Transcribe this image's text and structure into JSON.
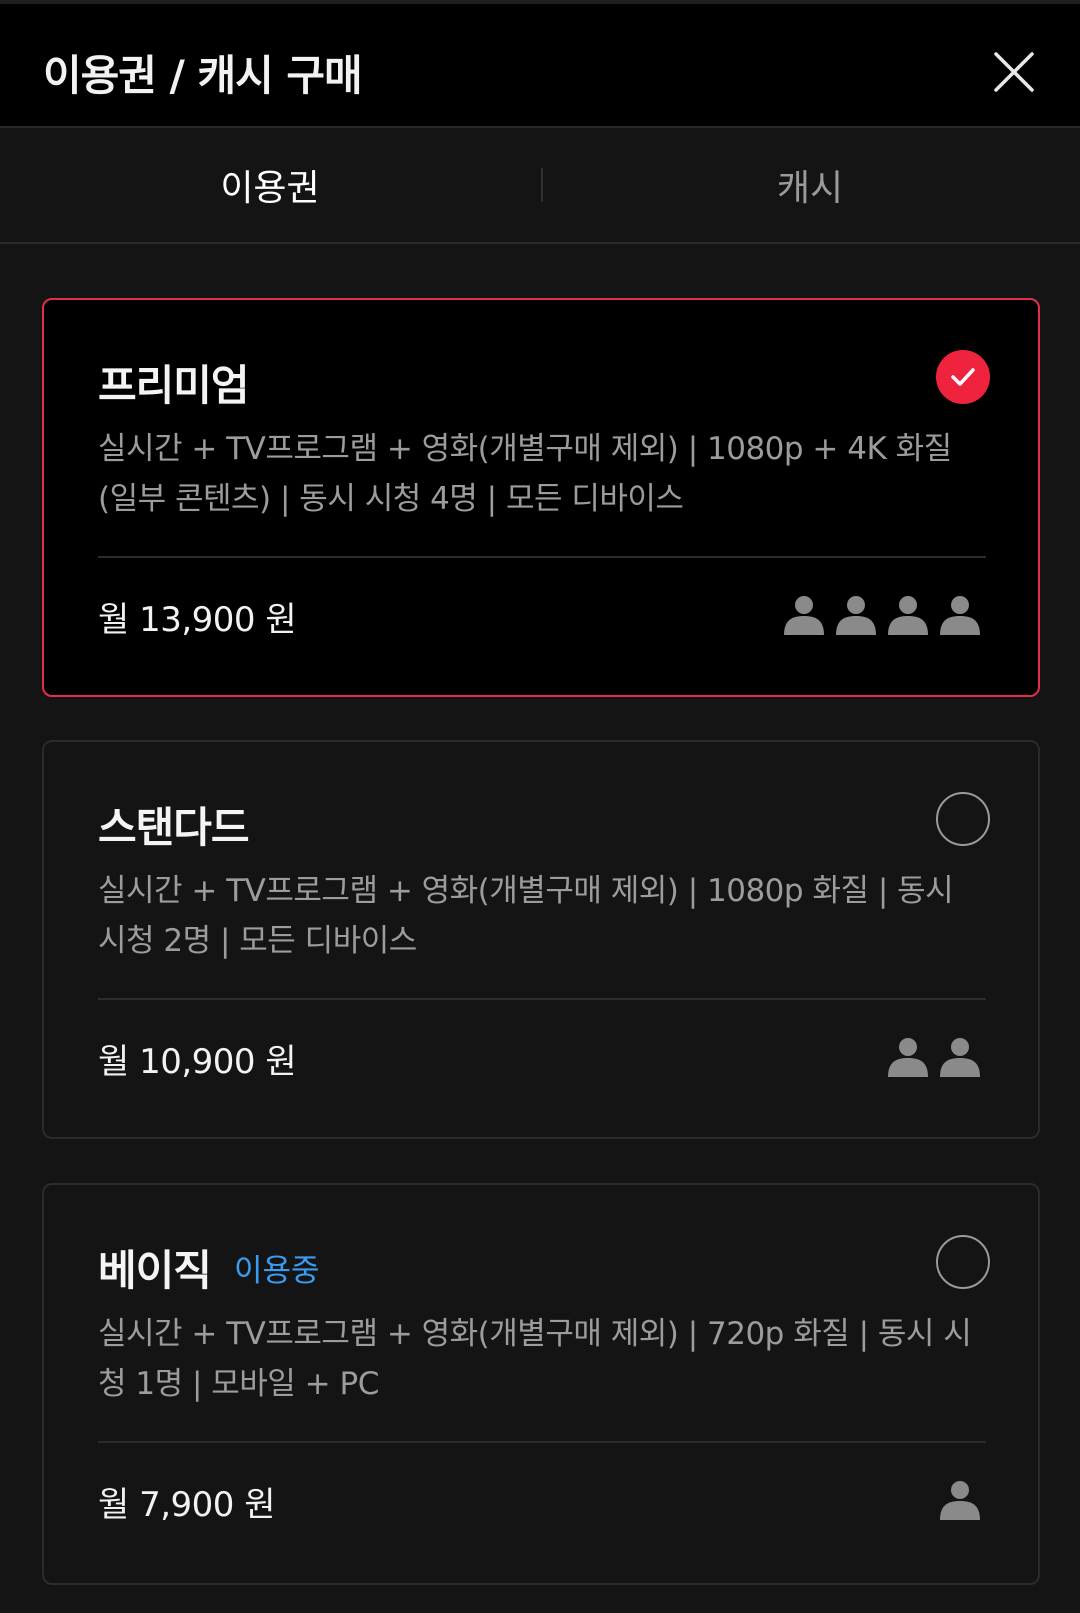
{
  "header": {
    "title": "이용권 / 캐시 구매",
    "close_icon": "close-icon"
  },
  "tabs": [
    {
      "label": "이용권",
      "active": true
    },
    {
      "label": "캐시",
      "active": false
    }
  ],
  "plans": [
    {
      "name": "프리미엄",
      "badge": "",
      "selected": true,
      "description": "실시간 + TV프로그램 + 영화(개별구매 제외) | 1080p + 4K 화질 (일부 콘텐츠) | 동시 시청 4명 | 모든 디바이스",
      "price": "월 13,900 원",
      "concurrent_users": 4
    },
    {
      "name": "스탠다드",
      "badge": "",
      "selected": false,
      "description": "실시간 + TV프로그램 + 영화(개별구매 제외) | 1080p 화질 | 동시 시청 2명 | 모든 디바이스",
      "price": "월 10,900 원",
      "concurrent_users": 2
    },
    {
      "name": "베이직",
      "badge": "이용중",
      "selected": false,
      "description": "실시간 + TV프로그램 + 영화(개별구매 제외) | 720p 화질 | 동시 시청 1명 | 모바일 + PC",
      "price": "월 7,900 원",
      "concurrent_users": 1
    }
  ],
  "colors": {
    "accent": "#f0233f",
    "selected_border": "#e52d4b",
    "badge": "#3a9cf0",
    "person_icon": "#8a8a8a"
  }
}
